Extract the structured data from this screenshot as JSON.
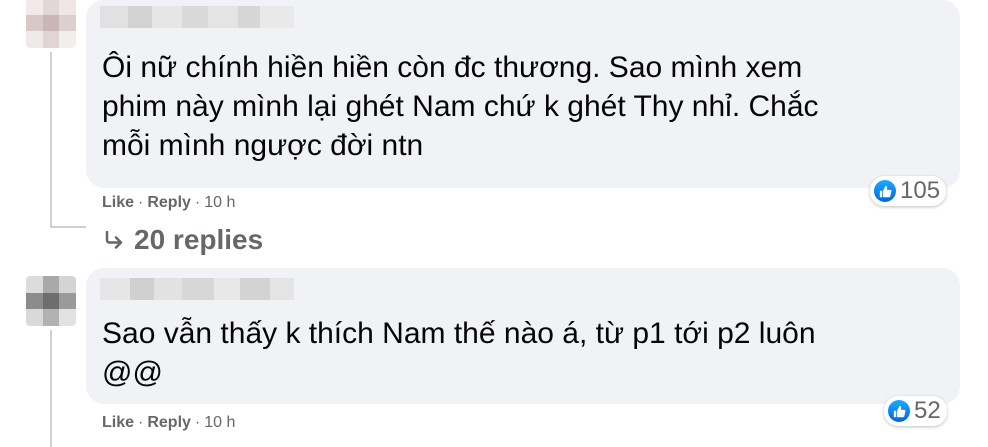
{
  "comments": [
    {
      "text": "Ôi nữ chính hiền hiền còn đc thương. Sao mình xem\nphim này mình lại ghét Nam chứ k ghét Thy nhỉ. Chắc\nmỗi mình ngược đời ntn",
      "like_label": "Like",
      "reply_label": "Reply",
      "time": "10 h",
      "reaction_count": "105",
      "reaction_icon": "like-icon",
      "replies_label": "20 replies"
    },
    {
      "text": "Sao vẫn thấy k thích Nam thế nào á, từ p1 tới p2 luôn\n@@",
      "like_label": "Like",
      "reply_label": "Reply",
      "time": "10 h",
      "reaction_count": "52",
      "reaction_icon": "like-icon"
    }
  ],
  "colors": {
    "bubble": "#f0f2f5",
    "text": "#050505",
    "secondary": "#65676b",
    "like_blue": "#0866ff"
  }
}
